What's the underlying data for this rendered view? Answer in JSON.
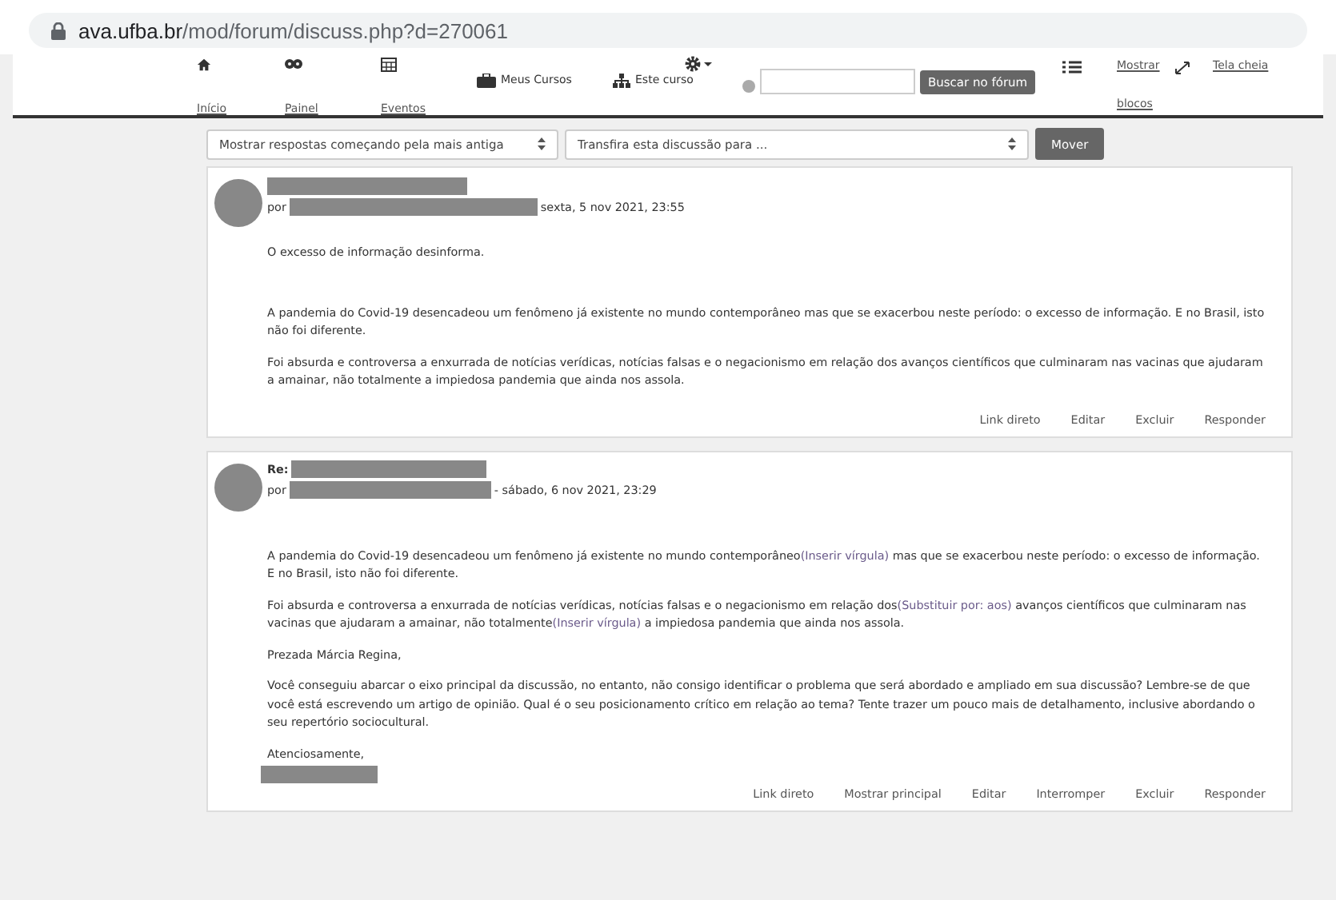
{
  "browser": {
    "host": "ava.ufba.br",
    "path": "/mod/forum/discuss.php?d=270061"
  },
  "navbar": {
    "items": [
      {
        "kind": "stacked",
        "label": "Início"
      },
      {
        "kind": "stacked",
        "label": "Painel"
      },
      {
        "kind": "stacked",
        "label": "Eventos"
      },
      {
        "kind": "inline",
        "label": "Meus Cursos"
      },
      {
        "kind": "inline",
        "label": "Este curso"
      },
      {
        "kind": "menu"
      },
      {
        "kind": "search",
        "button": "Buscar no fórum"
      },
      {
        "kind": "stacked",
        "label": "Mostrar blocos"
      },
      {
        "kind": "stacked",
        "label": "Tela cheia"
      }
    ]
  },
  "controls": {
    "sort_select": "Mostrar respostas começando pela mais antiga",
    "move_select": "Transfira esta discussão para ...",
    "move_button": "Mover"
  },
  "posts": [
    {
      "by": "por",
      "date": "sexta, 5 nov 2021, 23:55",
      "paragraphs": [
        [
          {
            "kind": "text",
            "text": "O excesso de informação desinforma."
          }
        ],
        [
          {
            "kind": "text",
            "text": "A pandemia do Covid-19 desencadeou um fenômeno já existente no mundo contemporâneo mas que se exacerbou neste período: o excesso de informação. E no Brasil, isto não foi diferente."
          }
        ],
        [
          {
            "kind": "text",
            "text": "Foi absurda e controversa a enxurrada de notícias verídicas, notícias falsas e o negacionismo em relação dos avanços científicos que culminaram nas vacinas que ajudaram a amainar, não totalmente a impiedosa pandemia que ainda nos assola."
          }
        ]
      ],
      "actions": [
        "Link direto",
        "Editar",
        "Excluir",
        "Responder"
      ]
    },
    {
      "subject_prefix": "Re:",
      "by": "por",
      "date": "- sábado, 6 nov 2021, 23:29",
      "paragraphs": [
        [
          {
            "kind": "text",
            "text": "A pandemia do Covid-19 desencadeou um fenômeno já existente no mundo contemporâneo"
          },
          {
            "kind": "note",
            "text": "(Inserir vírgula)"
          },
          {
            "kind": "text",
            "text": " mas que se exacerbou neste período: o excesso de informação. E no Brasil, isto não foi diferente."
          }
        ],
        [
          {
            "kind": "text",
            "text": "Foi absurda e controversa a enxurrada de notícias verídicas, notícias falsas e o negacionismo em relação dos"
          },
          {
            "kind": "note",
            "text": "(Substituir por: aos)"
          },
          {
            "kind": "text",
            "text": " avanços científicos que culminaram nas vacinas que ajudaram a amainar, não totalmente"
          },
          {
            "kind": "note",
            "text": "(Inserir vírgula)"
          },
          {
            "kind": "text",
            "text": " a impiedosa pandemia que ainda nos assola."
          }
        ],
        [
          {
            "kind": "text",
            "text": "Prezada Márcia Regina,"
          }
        ],
        [
          {
            "kind": "text",
            "text": "Você conseguiu abarcar o eixo principal da discussão, no entanto, não consigo identificar o problema que será abordado e ampliado em sua discussão? Lembre-se de que você está escrevendo um artigo de opinião. Qual é o seu posicionamento crítico em relação ao tema? Tente trazer um pouco mais de detalhamento, inclusive abordando o seu repertório sociocultural."
          }
        ]
      ],
      "closing": "Atenciosamente,",
      "actions": [
        "Link direto",
        "Mostrar principal",
        "Editar",
        "Interromper",
        "Excluir",
        "Responder"
      ]
    }
  ]
}
